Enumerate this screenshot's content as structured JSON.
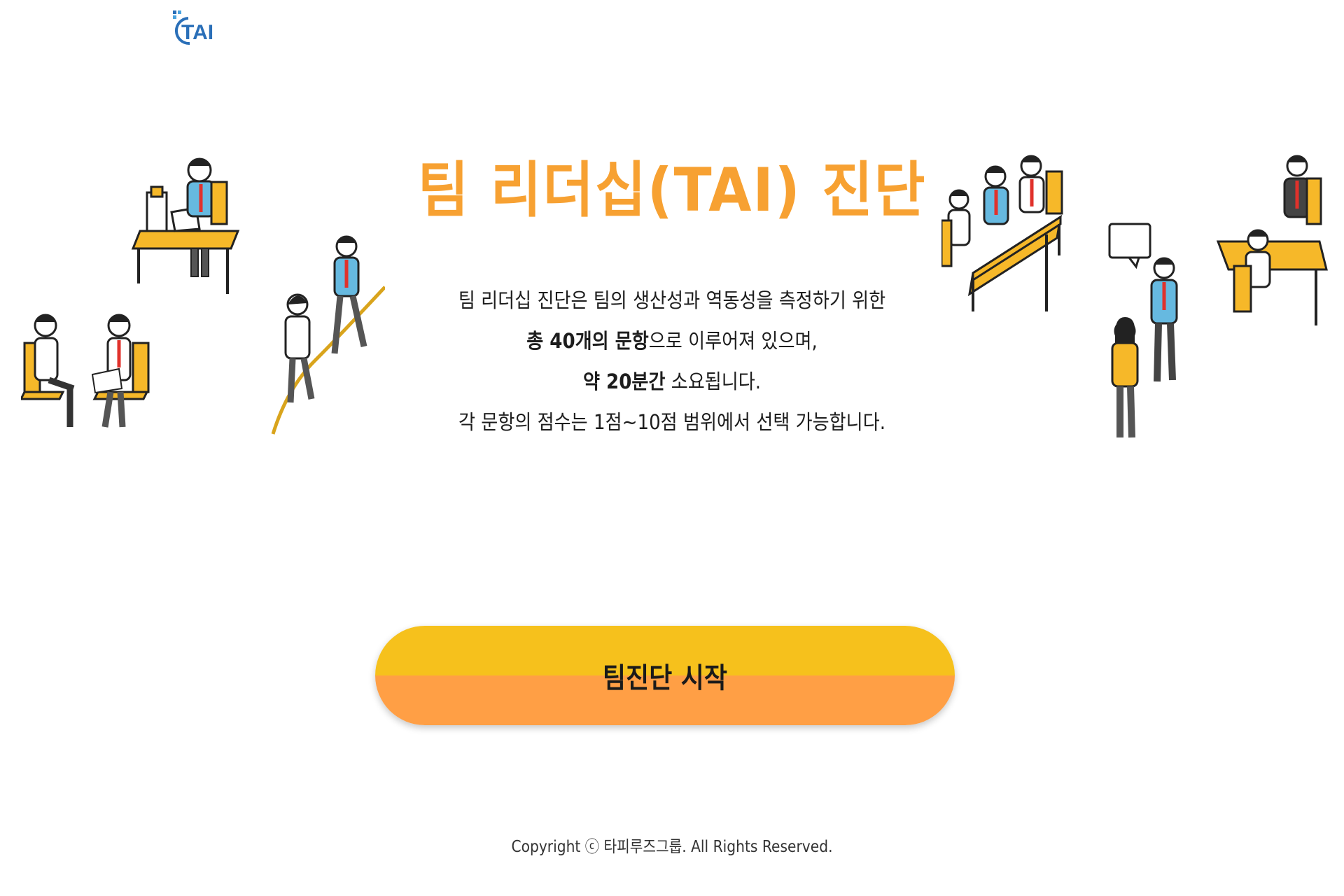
{
  "logo": {
    "text": "TAI"
  },
  "title": "팀 리더십(TAI) 진단",
  "description": {
    "line1": "팀 리더십 진단은 팀의 생산성과 역동성을 측정하기 위한",
    "line2_bold": "총 40개의 문항",
    "line2_rest": "으로 이루어져 있으며,",
    "line3_bold": "약 20분간",
    "line3_rest": " 소요됩니다.",
    "line4": "각 문항의 점수는 1점~10점 범위에서 선택 가능합니다."
  },
  "start_button": {
    "label": "팀진단 시작"
  },
  "footer": {
    "copyright": "Copyright ⓒ 타피루즈그룹. All Rights Reserved."
  },
  "colors": {
    "title": "#f7a132",
    "button_top": "#f6c11c",
    "button_bottom": "#ff9f45",
    "desk": "#f6b829",
    "shirt": "#66b9e0",
    "tie": "#e0312b"
  },
  "illustrations": {
    "left": "office-people-illustration-left",
    "right": "meeting-people-illustration-right"
  }
}
